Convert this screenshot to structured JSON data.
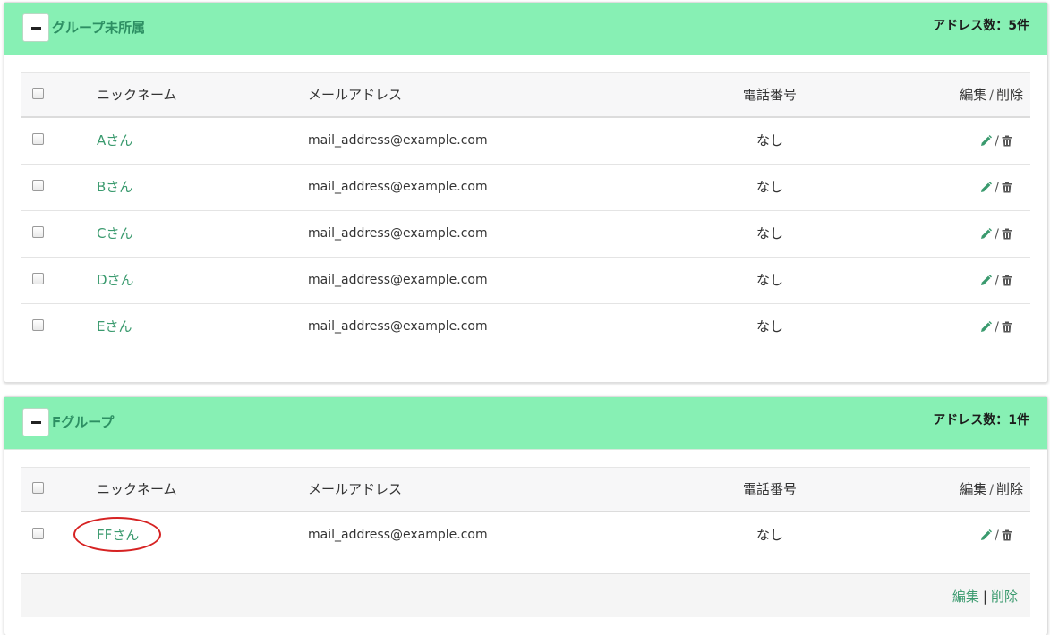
{
  "columns": {
    "nickname": "ニックネーム",
    "email": "メールアドレス",
    "phone": "電話番号",
    "edit": "編集",
    "delete": "削除",
    "separator": "/"
  },
  "groups": [
    {
      "title": "グループ未所属",
      "count_label": "アドレス数：5件",
      "rows": [
        {
          "nickname": "Aさん",
          "email": "mail_address@example.com",
          "phone": "なし"
        },
        {
          "nickname": "Bさん",
          "email": "mail_address@example.com",
          "phone": "なし"
        },
        {
          "nickname": "Cさん",
          "email": "mail_address@example.com",
          "phone": "なし"
        },
        {
          "nickname": "Dさん",
          "email": "mail_address@example.com",
          "phone": "なし"
        },
        {
          "nickname": "Eさん",
          "email": "mail_address@example.com",
          "phone": "なし"
        }
      ]
    },
    {
      "title": "Fグループ",
      "count_label": "アドレス数：1件",
      "rows": [
        {
          "nickname": "FFさん",
          "email": "mail_address@example.com",
          "phone": "なし"
        }
      ],
      "footer": {
        "edit_label": "編集",
        "separator": "|",
        "delete_label": "削除"
      }
    }
  ],
  "icons": {
    "collapse": "minus-icon",
    "edit": "pencil-icon",
    "delete": "trash-icon"
  },
  "colors": {
    "header_bg": "#87f0b4",
    "accent": "#3a9a6e",
    "highlight": "#d62222"
  }
}
